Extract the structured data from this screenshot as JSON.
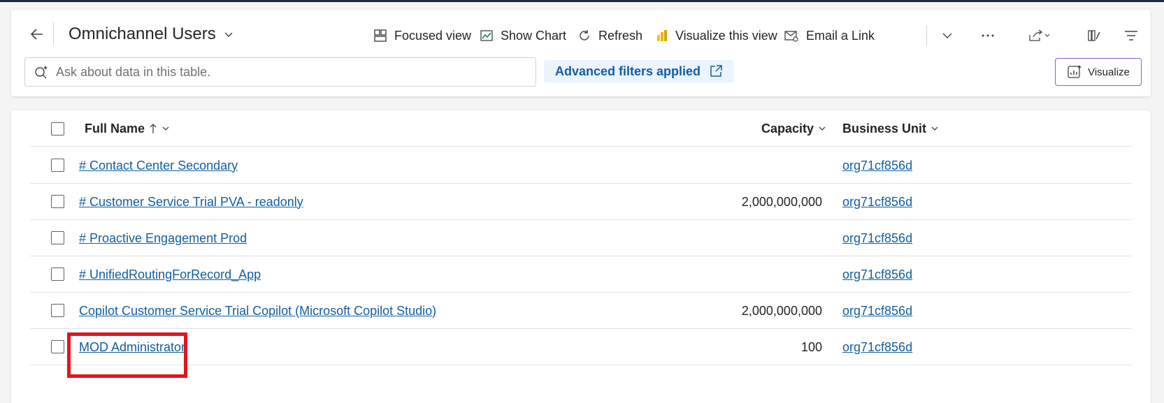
{
  "header": {
    "title": "Omnichannel Users",
    "commands": {
      "focused_view": "Focused view",
      "show_chart": "Show Chart",
      "refresh": "Refresh",
      "visualize_view": "Visualize this view",
      "email_link": "Email a Link"
    },
    "ask_placeholder": "Ask about data in this table.",
    "filters_label": "Advanced filters applied",
    "visualize_label": "Visualize"
  },
  "grid": {
    "columns": {
      "full_name": "Full Name",
      "capacity": "Capacity",
      "business_unit": "Business Unit"
    },
    "rows": [
      {
        "full_name": "# Contact Center Secondary",
        "capacity": "",
        "business_unit": "org71cf856d"
      },
      {
        "full_name": "# Customer Service Trial PVA - readonly",
        "capacity": "2,000,000,000",
        "business_unit": "org71cf856d"
      },
      {
        "full_name": "# Proactive Engagement Prod",
        "capacity": "",
        "business_unit": "org71cf856d"
      },
      {
        "full_name": "# UnifiedRoutingForRecord_App",
        "capacity": "",
        "business_unit": "org71cf856d"
      },
      {
        "full_name": "Copilot Customer Service Trial Copilot (Microsoft Copilot Studio)",
        "capacity": "2,000,000,000",
        "business_unit": "org71cf856d"
      },
      {
        "full_name": "MOD Administrator",
        "capacity": "100",
        "business_unit": "org71cf856d"
      }
    ]
  },
  "colors": {
    "link": "#115ea3",
    "highlight": "#e3141c",
    "visualize_border": "#8a5cd1"
  }
}
